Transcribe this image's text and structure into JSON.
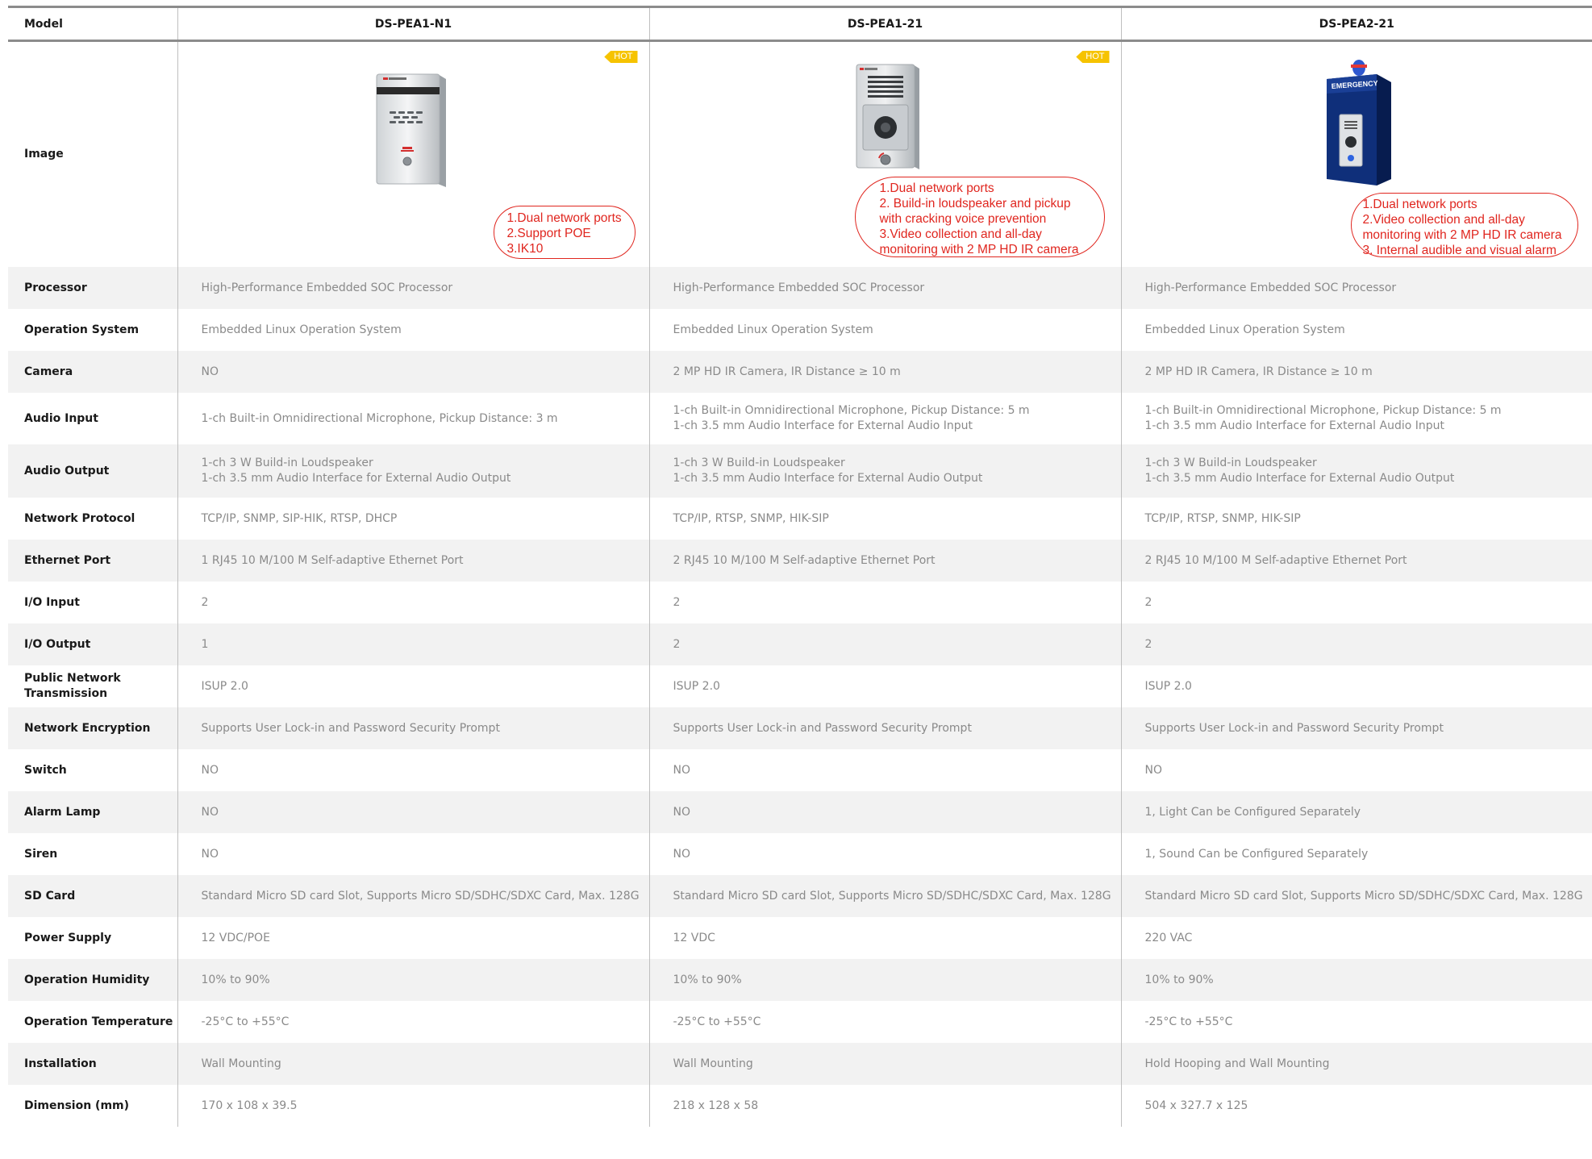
{
  "header": {
    "label": "Model",
    "products": [
      "DS-PEA1-N1",
      "DS-PEA1-21",
      "DS-PEA2-21"
    ]
  },
  "image_row": {
    "label": "Image",
    "hot_badge": "HOT",
    "callouts": [
      [
        "1.Dual network ports",
        "2.Support POE",
        "3.IK10"
      ],
      [
        "1.Dual network ports",
        "2. Build-in loudspeaker and pickup",
        "with cracking voice prevention",
        "3.Video collection and all-day",
        "monitoring with 2 MP HD IR camera"
      ],
      [
        "1.Dual network ports",
        "2.Video collection and all-day",
        "monitoring with 2 MP HD IR camera",
        "3. Internal audible and visual alarm"
      ]
    ],
    "device_labels": {
      "emergency": "EMERGENCY"
    }
  },
  "specs": [
    {
      "label": "Processor",
      "values": [
        [
          "High-Performance Embedded SOC Processor"
        ],
        [
          "High-Performance Embedded SOC Processor"
        ],
        [
          "High-Performance Embedded SOC Processor"
        ]
      ]
    },
    {
      "label": "Operation System",
      "values": [
        [
          "Embedded Linux Operation System"
        ],
        [
          "Embedded Linux Operation System"
        ],
        [
          "Embedded Linux Operation System"
        ]
      ]
    },
    {
      "label": "Camera",
      "values": [
        [
          "NO"
        ],
        [
          "2 MP HD IR Camera, IR Distance ≥ 10 m"
        ],
        [
          "2 MP HD IR Camera, IR Distance ≥ 10 m"
        ]
      ]
    },
    {
      "label": "Audio Input",
      "values": [
        [
          "1-ch Built-in Omnidirectional Microphone, Pickup Distance: 3 m"
        ],
        [
          "1-ch Built-in Omnidirectional Microphone, Pickup Distance: 5 m",
          "1-ch 3.5 mm Audio Interface for External Audio Input"
        ],
        [
          "1-ch Built-in Omnidirectional Microphone, Pickup Distance: 5 m",
          "1-ch 3.5 mm Audio Interface for External Audio Input"
        ]
      ]
    },
    {
      "label": "Audio Output",
      "values": [
        [
          "1-ch 3 W Build-in Loudspeaker",
          "1-ch 3.5 mm Audio Interface for External Audio Output"
        ],
        [
          "1-ch 3 W Build-in Loudspeaker",
          "1-ch 3.5 mm Audio Interface for External Audio Output"
        ],
        [
          "1-ch 3 W Build-in Loudspeaker",
          "1-ch 3.5 mm Audio Interface for External Audio Output"
        ]
      ]
    },
    {
      "label": "Network Protocol",
      "values": [
        [
          "TCP/IP, SNMP, SIP-HIK, RTSP, DHCP"
        ],
        [
          "TCP/IP, RTSP, SNMP, HIK-SIP"
        ],
        [
          "TCP/IP, RTSP, SNMP, HIK-SIP"
        ]
      ]
    },
    {
      "label": "Ethernet Port",
      "values": [
        [
          "1 RJ45 10 M/100 M Self-adaptive Ethernet Port"
        ],
        [
          "2 RJ45 10 M/100 M Self-adaptive Ethernet Port"
        ],
        [
          "2 RJ45 10 M/100 M Self-adaptive Ethernet Port"
        ]
      ]
    },
    {
      "label": "I/O Input",
      "values": [
        [
          "2"
        ],
        [
          "2"
        ],
        [
          "2"
        ]
      ]
    },
    {
      "label": "I/O Output",
      "values": [
        [
          "1"
        ],
        [
          "2"
        ],
        [
          "2"
        ]
      ]
    },
    {
      "label": "Public Network Transmission",
      "label_lines": [
        "Public Network",
        "Transmission"
      ],
      "values": [
        [
          "ISUP 2.0"
        ],
        [
          "ISUP 2.0"
        ],
        [
          "ISUP 2.0"
        ]
      ]
    },
    {
      "label": "Network Encryption",
      "values": [
        [
          "Supports User Lock-in and Password Security Prompt"
        ],
        [
          "Supports User Lock-in and Password Security Prompt"
        ],
        [
          "Supports User Lock-in and Password Security Prompt"
        ]
      ]
    },
    {
      "label": "Switch",
      "values": [
        [
          "NO"
        ],
        [
          "NO"
        ],
        [
          "NO"
        ]
      ]
    },
    {
      "label": "Alarm Lamp",
      "values": [
        [
          "NO"
        ],
        [
          "NO"
        ],
        [
          "1, Light Can be Configured Separately"
        ]
      ]
    },
    {
      "label": "Siren",
      "values": [
        [
          "NO"
        ],
        [
          "NO"
        ],
        [
          "1, Sound Can be Configured Separately"
        ]
      ]
    },
    {
      "label": "SD Card",
      "values": [
        [
          "Standard Micro SD card Slot, Supports Micro SD/SDHC/SDXC Card, Max. 128G"
        ],
        [
          "Standard Micro SD card Slot, Supports Micro SD/SDHC/SDXC Card, Max. 128G"
        ],
        [
          "Standard Micro SD card Slot, Supports Micro SD/SDHC/SDXC Card, Max. 128G"
        ]
      ]
    },
    {
      "label": "Power Supply",
      "values": [
        [
          "12 VDC/POE"
        ],
        [
          "12 VDC"
        ],
        [
          "220 VAC"
        ]
      ]
    },
    {
      "label": "Operation Humidity",
      "values": [
        [
          "10% to 90%"
        ],
        [
          "10% to 90%"
        ],
        [
          "10% to 90%"
        ]
      ]
    },
    {
      "label": "Operation Temperature",
      "values": [
        [
          "-25°C to +55°C"
        ],
        [
          "-25°C to +55°C"
        ],
        [
          "-25°C to +55°C"
        ]
      ]
    },
    {
      "label": "Installation",
      "values": [
        [
          "Wall Mounting"
        ],
        [
          "Wall Mounting"
        ],
        [
          "Hold Hooping and Wall Mounting"
        ]
      ]
    },
    {
      "label": "Dimension (mm)",
      "values": [
        [
          "170 x 108 x 39.5"
        ],
        [
          "218 x 128 x 58"
        ],
        [
          "504 x 327.7 x 125"
        ]
      ]
    }
  ]
}
